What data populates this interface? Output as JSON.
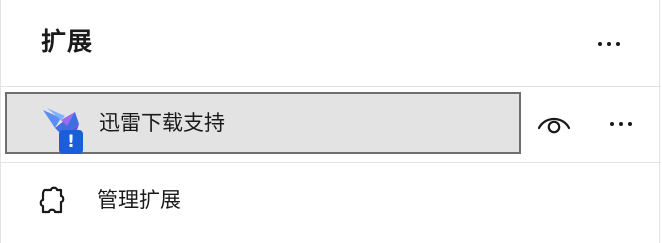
{
  "header": {
    "title": "扩展",
    "more_icon": "more-horizontal-icon"
  },
  "extensions": [
    {
      "name": "迅雷下载支持",
      "icon": "thunder-bird-icon",
      "badge": "!",
      "badge_color": "#1a5fd9",
      "visibility_icon": "eye-icon",
      "more_icon": "more-horizontal-icon"
    }
  ],
  "footer": {
    "manage_label": "管理扩展",
    "manage_icon": "puzzle-piece-icon"
  },
  "colors": {
    "selected_row_bg": "#e3e3e3",
    "selected_row_border": "#6e6e6e",
    "divider": "#e3e3e3"
  }
}
